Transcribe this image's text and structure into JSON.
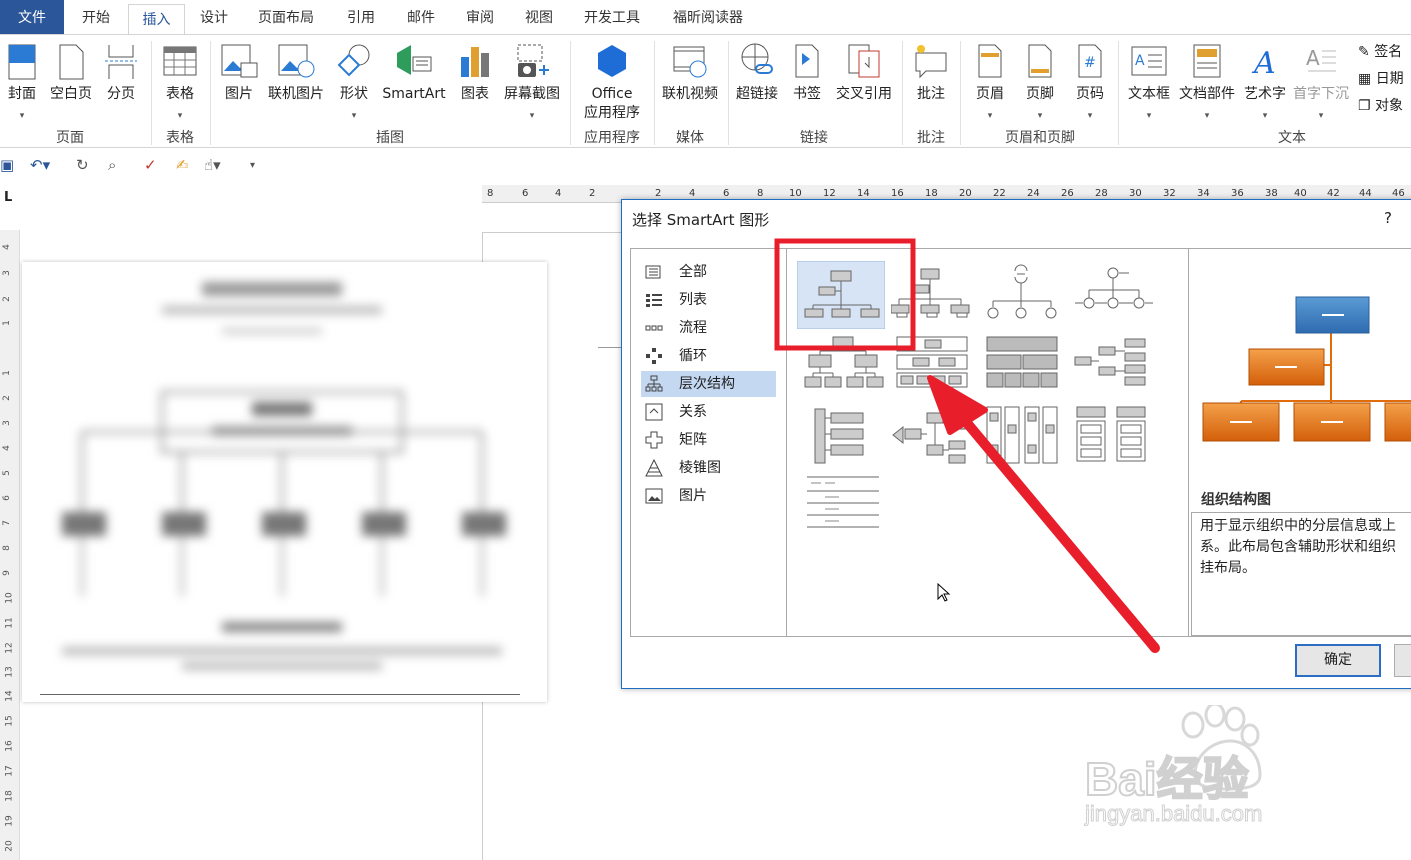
{
  "tabs": [
    "文件",
    "开始",
    "插入",
    "设计",
    "页面布局",
    "引用",
    "邮件",
    "审阅",
    "视图",
    "开发工具",
    "福昕阅读器"
  ],
  "ribbon": {
    "buttons": [
      "封面",
      "空白页",
      "分页",
      "表格",
      "图片",
      "联机图片",
      "形状",
      "SmartArt",
      "图表",
      "屏幕截图",
      "Office",
      "应用程序",
      "联机视频",
      "超链接",
      "书签",
      "交叉引用",
      "批注",
      "页眉",
      "页脚",
      "页码",
      "文本框",
      "文档部件",
      "艺术字",
      "首字下沉"
    ],
    "small": [
      "签名",
      "日期",
      "对象"
    ],
    "groups": [
      "页面",
      "表格",
      "插图",
      "应用程序",
      "媒体",
      "链接",
      "批注",
      "页眉和页脚",
      "文本"
    ]
  },
  "ruler": {
    "h": [
      "8",
      "6",
      "4",
      "2",
      "2",
      "4",
      "6",
      "8",
      "10",
      "12",
      "14",
      "16",
      "18",
      "20",
      "22",
      "24",
      "26",
      "28",
      "30",
      "32",
      "34",
      "36",
      "38",
      "40",
      "42",
      "44",
      "46"
    ],
    "v": [
      "4",
      "3",
      "2",
      "1",
      "1",
      "2",
      "3",
      "4",
      "5",
      "6",
      "7",
      "8",
      "9",
      "10",
      "11",
      "12",
      "13",
      "14",
      "15",
      "16",
      "17",
      "18",
      "19",
      "20"
    ]
  },
  "dialog": {
    "title": "选择 SmartArt 图形",
    "help": "?",
    "categories": [
      "全部",
      "列表",
      "流程",
      "循环",
      "层次结构",
      "关系",
      "矩阵",
      "棱锥图",
      "图片"
    ],
    "selected_category": "层次结构",
    "preview_name": "组织结构图",
    "preview_desc": "用于显示组织中的分层信息或上\n系。此布局包含辅助形状和组织\n挂布局。",
    "ok": "确定"
  },
  "colors": {
    "accent": "#2b579a",
    "annotation": "#e81e2a",
    "preview_top": "#2e75b6",
    "preview_child": "#e36c0a"
  },
  "watermark": {
    "brand": "Bai经验",
    "url": "jingyan.baidu.com"
  }
}
